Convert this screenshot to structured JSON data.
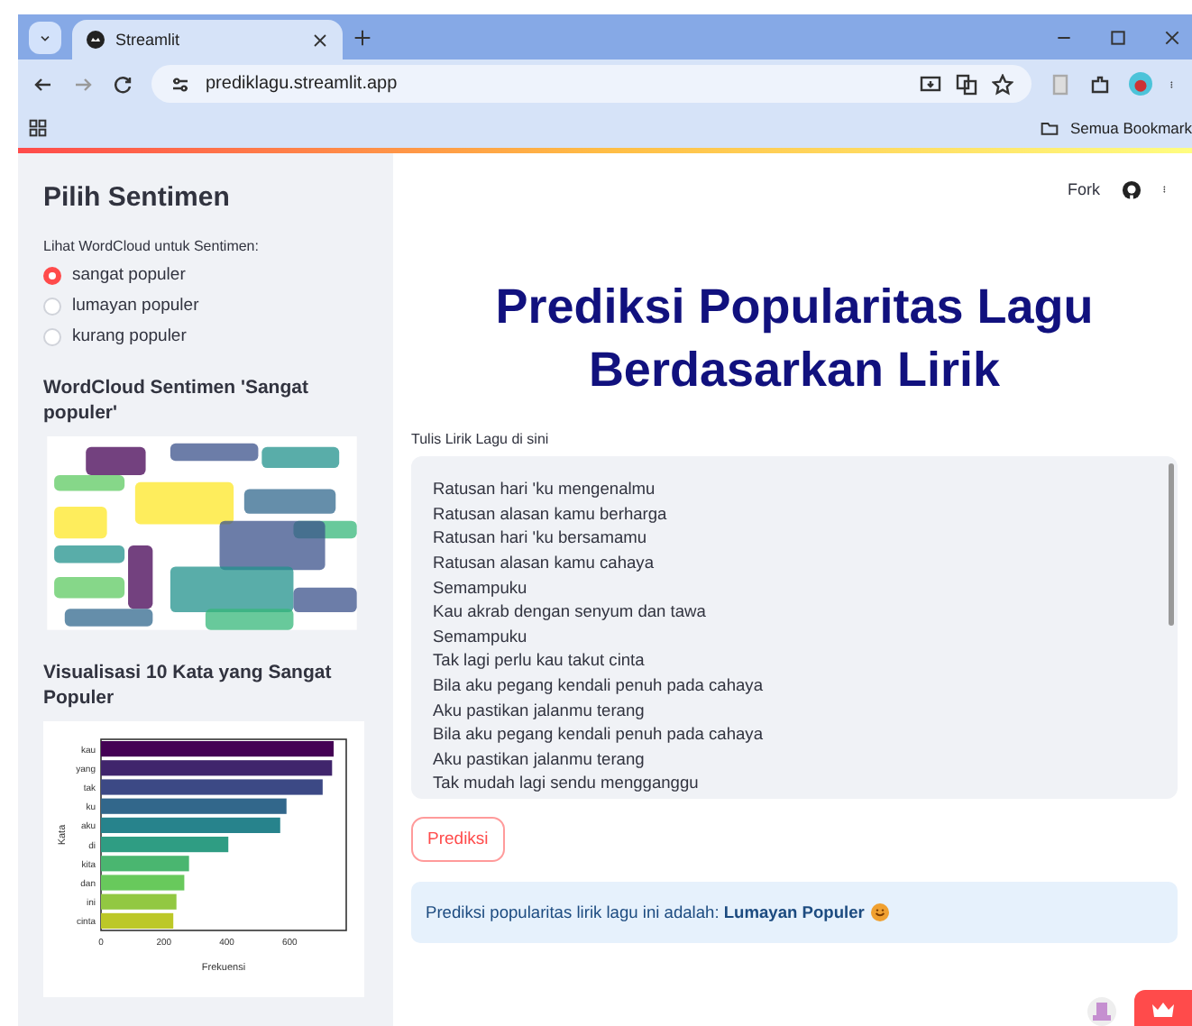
{
  "browser": {
    "tab_title": "Streamlit",
    "url": "prediklagu.streamlit.app",
    "bookmarks_folder": "Semua Bookmark"
  },
  "sidebar": {
    "title": "Pilih Sentimen",
    "radio_label": "Lihat WordCloud untuk Sentimen:",
    "options": [
      {
        "label": "sangat populer",
        "selected": true
      },
      {
        "label": "lumayan populer",
        "selected": false
      },
      {
        "label": "kurang populer",
        "selected": false
      }
    ],
    "wordcloud_title": "WordCloud Sentimen 'Sangat populer'",
    "chart_title": "Visualisasi 10 Kata yang Sangat Populer",
    "chart_data": {
      "type": "bar",
      "orientation": "horizontal",
      "xlabel": "Frekuensi",
      "ylabel": "Kata",
      "categories": [
        "kau",
        "yang",
        "tak",
        "ku",
        "aku",
        "di",
        "kita",
        "dan",
        "ini",
        "cinta"
      ],
      "values": [
        740,
        735,
        705,
        590,
        570,
        405,
        280,
        265,
        240,
        230
      ],
      "xlim": [
        0,
        780
      ],
      "xticks": [
        0,
        200,
        400,
        600
      ]
    }
  },
  "header": {
    "fork": "Fork"
  },
  "main": {
    "title": "Prediksi Popularitas Lagu Berdasarkan Lirik",
    "textarea_label": "Tulis Lirik Lagu di sini",
    "lyrics": [
      "Ratusan hari 'ku mengenalmu",
      "Ratusan alasan kamu berharga",
      "Ratusan hari 'ku bersamamu",
      "Ratusan alasan kamu cahaya",
      "Semampuku",
      "Kau akrab dengan senyum dan tawa",
      "Semampuku",
      "Tak lagi perlu kau takut cinta",
      "Bila aku pegang kendali penuh pada cahaya",
      "Aku pastikan jalanmu terang",
      "Bila aku pegang kendali penuh pada cahaya",
      "Aku pastikan jalanmu terang",
      "Tak mudah lagi sendu mengganggu"
    ],
    "button": "Prediksi",
    "result": "Prediksi popularitas lirik lagu ini adalah: **Lumayan Populer**"
  }
}
